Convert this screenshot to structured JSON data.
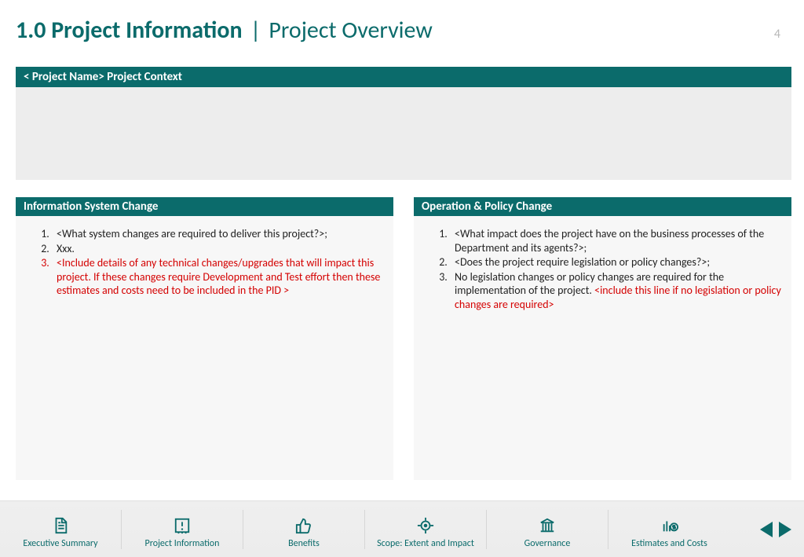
{
  "header": {
    "title_bold": "1.0 Project Information",
    "separator": "|",
    "title_light": "Project Overview",
    "page_number": "4"
  },
  "context": {
    "bar": "< Project Name> Project Context"
  },
  "left": {
    "header": "Information System Change",
    "items": [
      {
        "text": "<What system changes are required to deliver this project?>;",
        "red": false
      },
      {
        "text": "Xxx.",
        "red": false
      },
      {
        "text": "<Include details of any technical changes/upgrades that will impact this project. If these changes require Development and Test effort then these estimates and costs need to be included in the PID >",
        "red": true
      }
    ]
  },
  "right": {
    "header": "Operation & Policy Change",
    "items": [
      {
        "text": "<What impact does the project have on the business processes of the Department and its agents?>;",
        "red": false
      },
      {
        "text": "<Does the project require legislation or policy changes?>;",
        "red": false
      },
      {
        "text": "No legislation changes or policy changes are required for the implementation of the project. ",
        "red": false,
        "tail_red": "<include this line if no legislation or policy changes are required>"
      }
    ]
  },
  "footer": {
    "items": [
      {
        "label": "Executive Summary",
        "icon": "document"
      },
      {
        "label": "Project Information",
        "icon": "info"
      },
      {
        "label": "Benefits",
        "icon": "thumb"
      },
      {
        "label": "Scope: Extent and Impact",
        "icon": "target"
      },
      {
        "label": "Governance",
        "icon": "building"
      },
      {
        "label": "Estimates and Costs",
        "icon": "money"
      }
    ]
  }
}
